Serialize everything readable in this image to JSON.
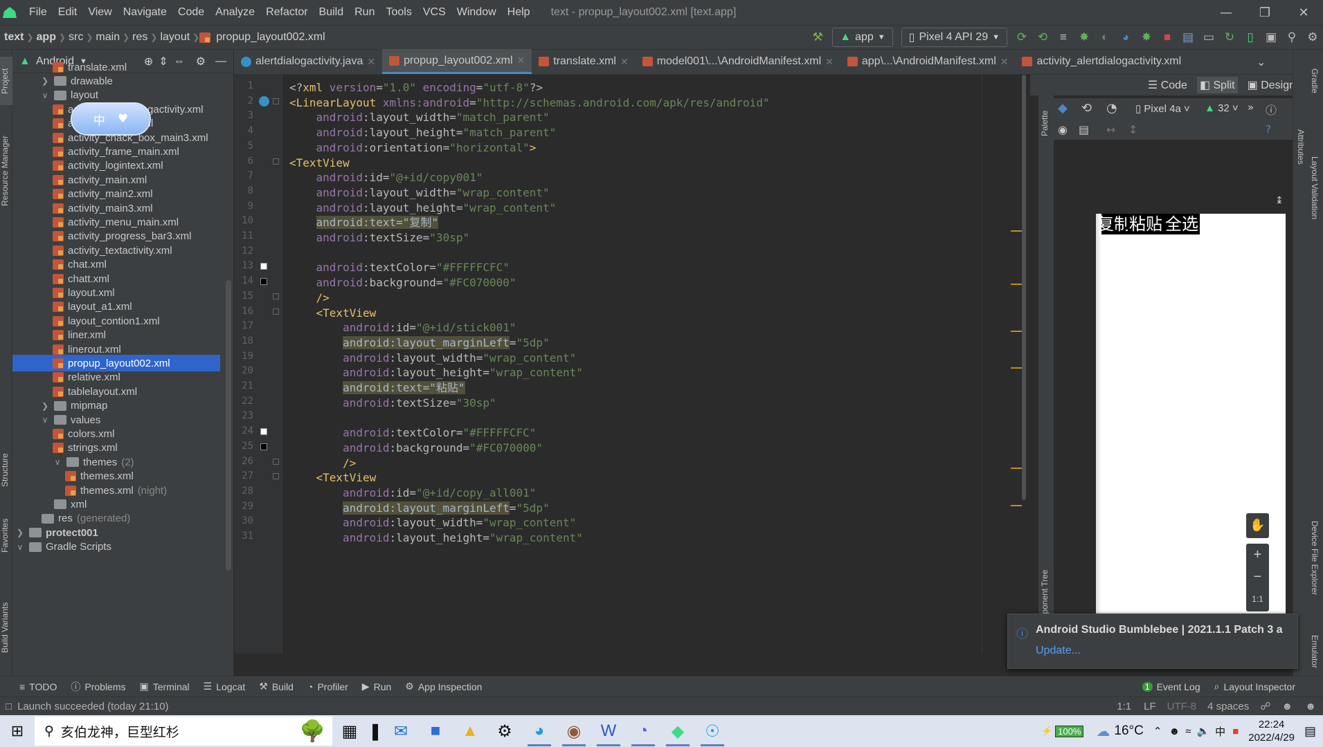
{
  "menubar": {
    "items": [
      "File",
      "Edit",
      "View",
      "Navigate",
      "Code",
      "Analyze",
      "Refactor",
      "Build",
      "Run",
      "Tools",
      "VCS",
      "Window",
      "Help"
    ],
    "window_title": "text - propup_layout002.xml [text.app]"
  },
  "navbar": {
    "breadcrumbs": [
      "text",
      "app",
      "src",
      "main",
      "res",
      "layout",
      "propup_layout002.xml"
    ],
    "run_config": "app",
    "device": "Pixel 4 API 29"
  },
  "project": {
    "view": "Android",
    "tree": [
      {
        "label": "translate.xml",
        "level": 4,
        "type": "xml"
      },
      {
        "label": "drawable",
        "level": 3,
        "type": "folder",
        "arrow": ">"
      },
      {
        "label": "layout",
        "level": 3,
        "type": "folder",
        "arrow": "v"
      },
      {
        "label": "activity_alertdialogactivity.xml",
        "level": 4,
        "type": "xml"
      },
      {
        "label": "activity_button.xml",
        "level": 4,
        "type": "xml"
      },
      {
        "label": "activity_chack_box_main3.xml",
        "level": 4,
        "type": "xml"
      },
      {
        "label": "activity_frame_main.xml",
        "level": 4,
        "type": "xml"
      },
      {
        "label": "activity_logintext.xml",
        "level": 4,
        "type": "xml"
      },
      {
        "label": "activity_main.xml",
        "level": 4,
        "type": "xml"
      },
      {
        "label": "activity_main2.xml",
        "level": 4,
        "type": "xml"
      },
      {
        "label": "activity_main3.xml",
        "level": 4,
        "type": "xml"
      },
      {
        "label": "activity_menu_main.xml",
        "level": 4,
        "type": "xml"
      },
      {
        "label": "activity_progress_bar3.xml",
        "level": 4,
        "type": "xml"
      },
      {
        "label": "activity_textactivity.xml",
        "level": 4,
        "type": "xml"
      },
      {
        "label": "chat.xml",
        "level": 4,
        "type": "xml"
      },
      {
        "label": "chatt.xml",
        "level": 4,
        "type": "xml"
      },
      {
        "label": "layout.xml",
        "level": 4,
        "type": "xml"
      },
      {
        "label": "layout_a1.xml",
        "level": 4,
        "type": "xml"
      },
      {
        "label": "layout_contion1.xml",
        "level": 4,
        "type": "xml"
      },
      {
        "label": "liner.xml",
        "level": 4,
        "type": "xml"
      },
      {
        "label": "linerout.xml",
        "level": 4,
        "type": "xml"
      },
      {
        "label": "propup_layout002.xml",
        "level": 4,
        "type": "xml",
        "selected": true
      },
      {
        "label": "relative.xml",
        "level": 4,
        "type": "xml"
      },
      {
        "label": "tablelayout.xml",
        "level": 4,
        "type": "xml"
      },
      {
        "label": "mipmap",
        "level": 3,
        "type": "folder",
        "arrow": ">"
      },
      {
        "label": "values",
        "level": 3,
        "type": "folder",
        "arrow": "v"
      },
      {
        "label": "colors.xml",
        "level": 4,
        "type": "xml"
      },
      {
        "label": "strings.xml",
        "level": 4,
        "type": "xml"
      },
      {
        "label": "themes",
        "suffix": "(2)",
        "level": 4,
        "type": "folder",
        "arrow": "v"
      },
      {
        "label": "themes.xml",
        "level": 5,
        "type": "xml"
      },
      {
        "label": "themes.xml",
        "suffix": "(night)",
        "level": 5,
        "type": "xml"
      },
      {
        "label": "xml",
        "level": 3,
        "type": "folder"
      },
      {
        "label": "res",
        "suffix": "(generated)",
        "level": 2,
        "type": "folder"
      },
      {
        "label": "protect001",
        "level": 1,
        "type": "folder",
        "arrow": ">",
        "bold": true
      },
      {
        "label": "Gradle Scripts",
        "level": 1,
        "type": "folder",
        "arrow": "v"
      }
    ]
  },
  "ime": {
    "label": "中"
  },
  "tabs": [
    "alertdialogactivity.java",
    "propup_layout002.xml",
    "translate.xml",
    "model001\\...\\AndroidManifest.xml",
    "app\\...\\AndroidManifest.xml",
    "activity_alertdialogactivity.xml"
  ],
  "editor": {
    "lines": [
      [
        [
          "pn",
          "<?"
        ],
        [
          "tg",
          "xml "
        ],
        [
          "an",
          "version"
        ],
        [
          "pn",
          "="
        ],
        [
          "av",
          "\"1.0\" "
        ],
        [
          "an",
          "encoding"
        ],
        [
          "pn",
          "="
        ],
        [
          "av",
          "\"utf-8\""
        ],
        [
          "pn",
          "?>"
        ]
      ],
      [
        [
          "tg",
          "<LinearLayout "
        ],
        [
          "an",
          "xmlns:android"
        ],
        [
          "pn",
          "="
        ],
        [
          "av",
          "\"http://schemas.android.com/apk/res/android\""
        ]
      ],
      [
        [
          "pn",
          "    "
        ],
        [
          "an",
          "android"
        ],
        [
          "pn",
          ":layout_width="
        ],
        [
          "av",
          "\"match_parent\""
        ]
      ],
      [
        [
          "pn",
          "    "
        ],
        [
          "an",
          "android"
        ],
        [
          "pn",
          ":layout_height="
        ],
        [
          "av",
          "\"match_parent\""
        ]
      ],
      [
        [
          "pn",
          "    "
        ],
        [
          "an",
          "android"
        ],
        [
          "pn",
          ":orientation="
        ],
        [
          "av",
          "\"horizontal\""
        ],
        [
          "tg",
          ">"
        ]
      ],
      [
        [
          "tg",
          "<TextView"
        ]
      ],
      [
        [
          "pn",
          "    "
        ],
        [
          "an",
          "android"
        ],
        [
          "pn",
          ":id="
        ],
        [
          "av",
          "\"@+id/copy001\""
        ]
      ],
      [
        [
          "pn",
          "    "
        ],
        [
          "an",
          "android"
        ],
        [
          "pn",
          ":layout_width="
        ],
        [
          "av",
          "\"wrap_content\""
        ]
      ],
      [
        [
          "pn",
          "    "
        ],
        [
          "an",
          "android"
        ],
        [
          "pn",
          ":layout_height="
        ],
        [
          "av",
          "\"wrap_content\""
        ]
      ],
      [
        [
          "pn",
          "    "
        ],
        [
          "hl",
          "android:text=\"复制\""
        ]
      ],
      [
        [
          "pn",
          "    "
        ],
        [
          "an",
          "android"
        ],
        [
          "pn",
          ":textSize="
        ],
        [
          "av",
          "\"30sp\""
        ]
      ],
      [],
      [
        [
          "pn",
          "    "
        ],
        [
          "an",
          "android"
        ],
        [
          "pn",
          ":textColor="
        ],
        [
          "av",
          "\"#FFFFFCFC\""
        ]
      ],
      [
        [
          "pn",
          "    "
        ],
        [
          "an",
          "android"
        ],
        [
          "pn",
          ":background="
        ],
        [
          "av",
          "\"#FC070000\""
        ]
      ],
      [
        [
          "pn",
          "    "
        ],
        [
          "tg",
          "/>"
        ]
      ],
      [
        [
          "pn",
          "    "
        ],
        [
          "tg",
          "<TextView"
        ]
      ],
      [
        [
          "pn",
          "        "
        ],
        [
          "an",
          "android"
        ],
        [
          "pn",
          ":id="
        ],
        [
          "av",
          "\"@+id/stick001\""
        ]
      ],
      [
        [
          "pn",
          "        "
        ],
        [
          "hl",
          "android:layout_marginLeft"
        ],
        [
          "pn",
          "="
        ],
        [
          "av",
          "\"5dp\""
        ]
      ],
      [
        [
          "pn",
          "        "
        ],
        [
          "an",
          "android"
        ],
        [
          "pn",
          ":layout_width="
        ],
        [
          "av",
          "\"wrap_content\""
        ]
      ],
      [
        [
          "pn",
          "        "
        ],
        [
          "an",
          "android"
        ],
        [
          "pn",
          ":layout_height="
        ],
        [
          "av",
          "\"wrap_content\""
        ]
      ],
      [
        [
          "pn",
          "        "
        ],
        [
          "hl",
          "android:text=\"粘贴\""
        ]
      ],
      [
        [
          "pn",
          "        "
        ],
        [
          "an",
          "android"
        ],
        [
          "pn",
          ":textSize="
        ],
        [
          "av",
          "\"30sp\""
        ]
      ],
      [],
      [
        [
          "pn",
          "        "
        ],
        [
          "an",
          "android"
        ],
        [
          "pn",
          ":textColor="
        ],
        [
          "av",
          "\"#FFFFFCFC\""
        ]
      ],
      [
        [
          "pn",
          "        "
        ],
        [
          "an",
          "android"
        ],
        [
          "pn",
          ":background="
        ],
        [
          "av",
          "\"#FC070000\""
        ]
      ],
      [
        [
          "pn",
          "        "
        ],
        [
          "tg",
          "/>"
        ]
      ],
      [
        [
          "pn",
          "    "
        ],
        [
          "tg",
          "<TextView"
        ]
      ],
      [
        [
          "pn",
          "        "
        ],
        [
          "an",
          "android"
        ],
        [
          "pn",
          ":id="
        ],
        [
          "av",
          "\"@+id/copy_all001\""
        ]
      ],
      [
        [
          "pn",
          "        "
        ],
        [
          "hl",
          "android:layout_marginLeft"
        ],
        [
          "pn",
          "="
        ],
        [
          "av",
          "\"5dp\""
        ]
      ],
      [
        [
          "pn",
          "        "
        ],
        [
          "an",
          "android"
        ],
        [
          "pn",
          ":layout_width="
        ],
        [
          "av",
          "\"wrap_content\""
        ]
      ],
      [
        [
          "pn",
          "        "
        ],
        [
          "an",
          "android"
        ],
        [
          "pn",
          ":layout_height="
        ],
        [
          "av",
          "\"wrap_content\""
        ]
      ]
    ]
  },
  "design": {
    "view_modes": [
      "Code",
      "Split",
      "Design"
    ],
    "device": "Pixel 4a",
    "api": "32",
    "palette_label": "Palette",
    "component_tree_label": "Component Tree",
    "zoom_reset": "1:1",
    "preview_texts": [
      "复制",
      "粘贴",
      "全选"
    ]
  },
  "right_tabs": [
    "Gradle",
    "Attributes",
    "Layout Validation",
    "Device File Explorer",
    "Emulator"
  ],
  "left_tabs": [
    "Project",
    "Resource Manager",
    "Structure",
    "Favorites",
    "Build Variants"
  ],
  "notification": {
    "title": "Android Studio Bumblebee | 2021.1.1 Patch 3 a",
    "link": "Update..."
  },
  "bottom_tools": [
    "TODO",
    "Problems",
    "Terminal",
    "Logcat",
    "Build",
    "Profiler",
    "Run",
    "App Inspection"
  ],
  "bottom_tools_right": [
    "Event Log",
    "Layout Inspector"
  ],
  "event_count": "1",
  "status": {
    "message": "Launch succeeded (today 21:10)",
    "pos": "1:1",
    "line_sep": "LF",
    "encoding": "UTF-8",
    "indent": "4 spaces"
  },
  "taskbar": {
    "search_text": "亥伯龙神，巨型红杉",
    "battery": "100%",
    "temp": "16°C",
    "time": "22:24",
    "date": "2022/4/29",
    "ime": "中"
  },
  "colors": {
    "accent": "#2f65ca",
    "tab_underline": "#4a88c7",
    "warning": "#be9117"
  }
}
